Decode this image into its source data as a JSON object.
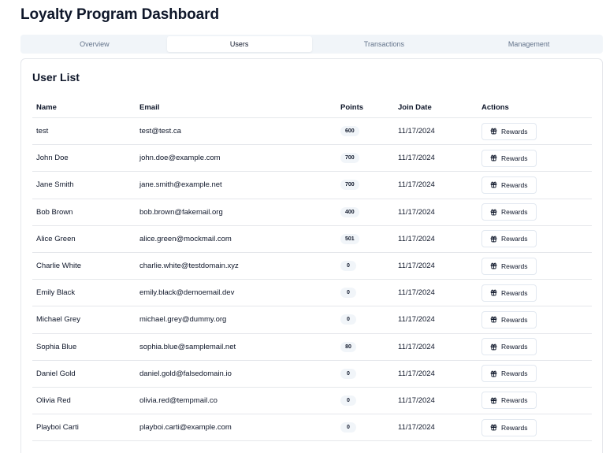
{
  "page": {
    "title": "Loyalty Program Dashboard"
  },
  "tabs": [
    {
      "label": "Overview",
      "active": false
    },
    {
      "label": "Users",
      "active": true
    },
    {
      "label": "Transactions",
      "active": false
    },
    {
      "label": "Management",
      "active": false
    }
  ],
  "user_list": {
    "title": "User List",
    "columns": {
      "name": "Name",
      "email": "Email",
      "points": "Points",
      "join_date": "Join Date",
      "actions": "Actions"
    },
    "action_label": "Rewards",
    "action_icon": "gift-icon",
    "rows": [
      {
        "name": "test",
        "email": "test@test.ca",
        "points": "600",
        "join_date": "11/17/2024"
      },
      {
        "name": "John Doe",
        "email": "john.doe@example.com",
        "points": "700",
        "join_date": "11/17/2024"
      },
      {
        "name": "Jane Smith",
        "email": "jane.smith@example.net",
        "points": "700",
        "join_date": "11/17/2024"
      },
      {
        "name": "Bob Brown",
        "email": "bob.brown@fakemail.org",
        "points": "400",
        "join_date": "11/17/2024"
      },
      {
        "name": "Alice Green",
        "email": "alice.green@mockmail.com",
        "points": "501",
        "join_date": "11/17/2024"
      },
      {
        "name": "Charlie White",
        "email": "charlie.white@testdomain.xyz",
        "points": "0",
        "join_date": "11/17/2024"
      },
      {
        "name": "Emily Black",
        "email": "emily.black@demoemail.dev",
        "points": "0",
        "join_date": "11/17/2024"
      },
      {
        "name": "Michael Grey",
        "email": "michael.grey@dummy.org",
        "points": "0",
        "join_date": "11/17/2024"
      },
      {
        "name": "Sophia Blue",
        "email": "sophia.blue@samplemail.net",
        "points": "80",
        "join_date": "11/17/2024"
      },
      {
        "name": "Daniel Gold",
        "email": "daniel.gold@falsedomain.io",
        "points": "0",
        "join_date": "11/17/2024"
      },
      {
        "name": "Olivia Red",
        "email": "olivia.red@tempmail.co",
        "points": "0",
        "join_date": "11/17/2024"
      },
      {
        "name": "Playboi Carti",
        "email": "playboi.carti@example.com",
        "points": "0",
        "join_date": "11/17/2024"
      }
    ]
  },
  "colors": {
    "tab_bar_bg": "#f1f5f9",
    "border": "#e5e7eb",
    "badge_bg": "#f1f5f9",
    "muted_text": "#64748b",
    "text": "#0f172a"
  }
}
